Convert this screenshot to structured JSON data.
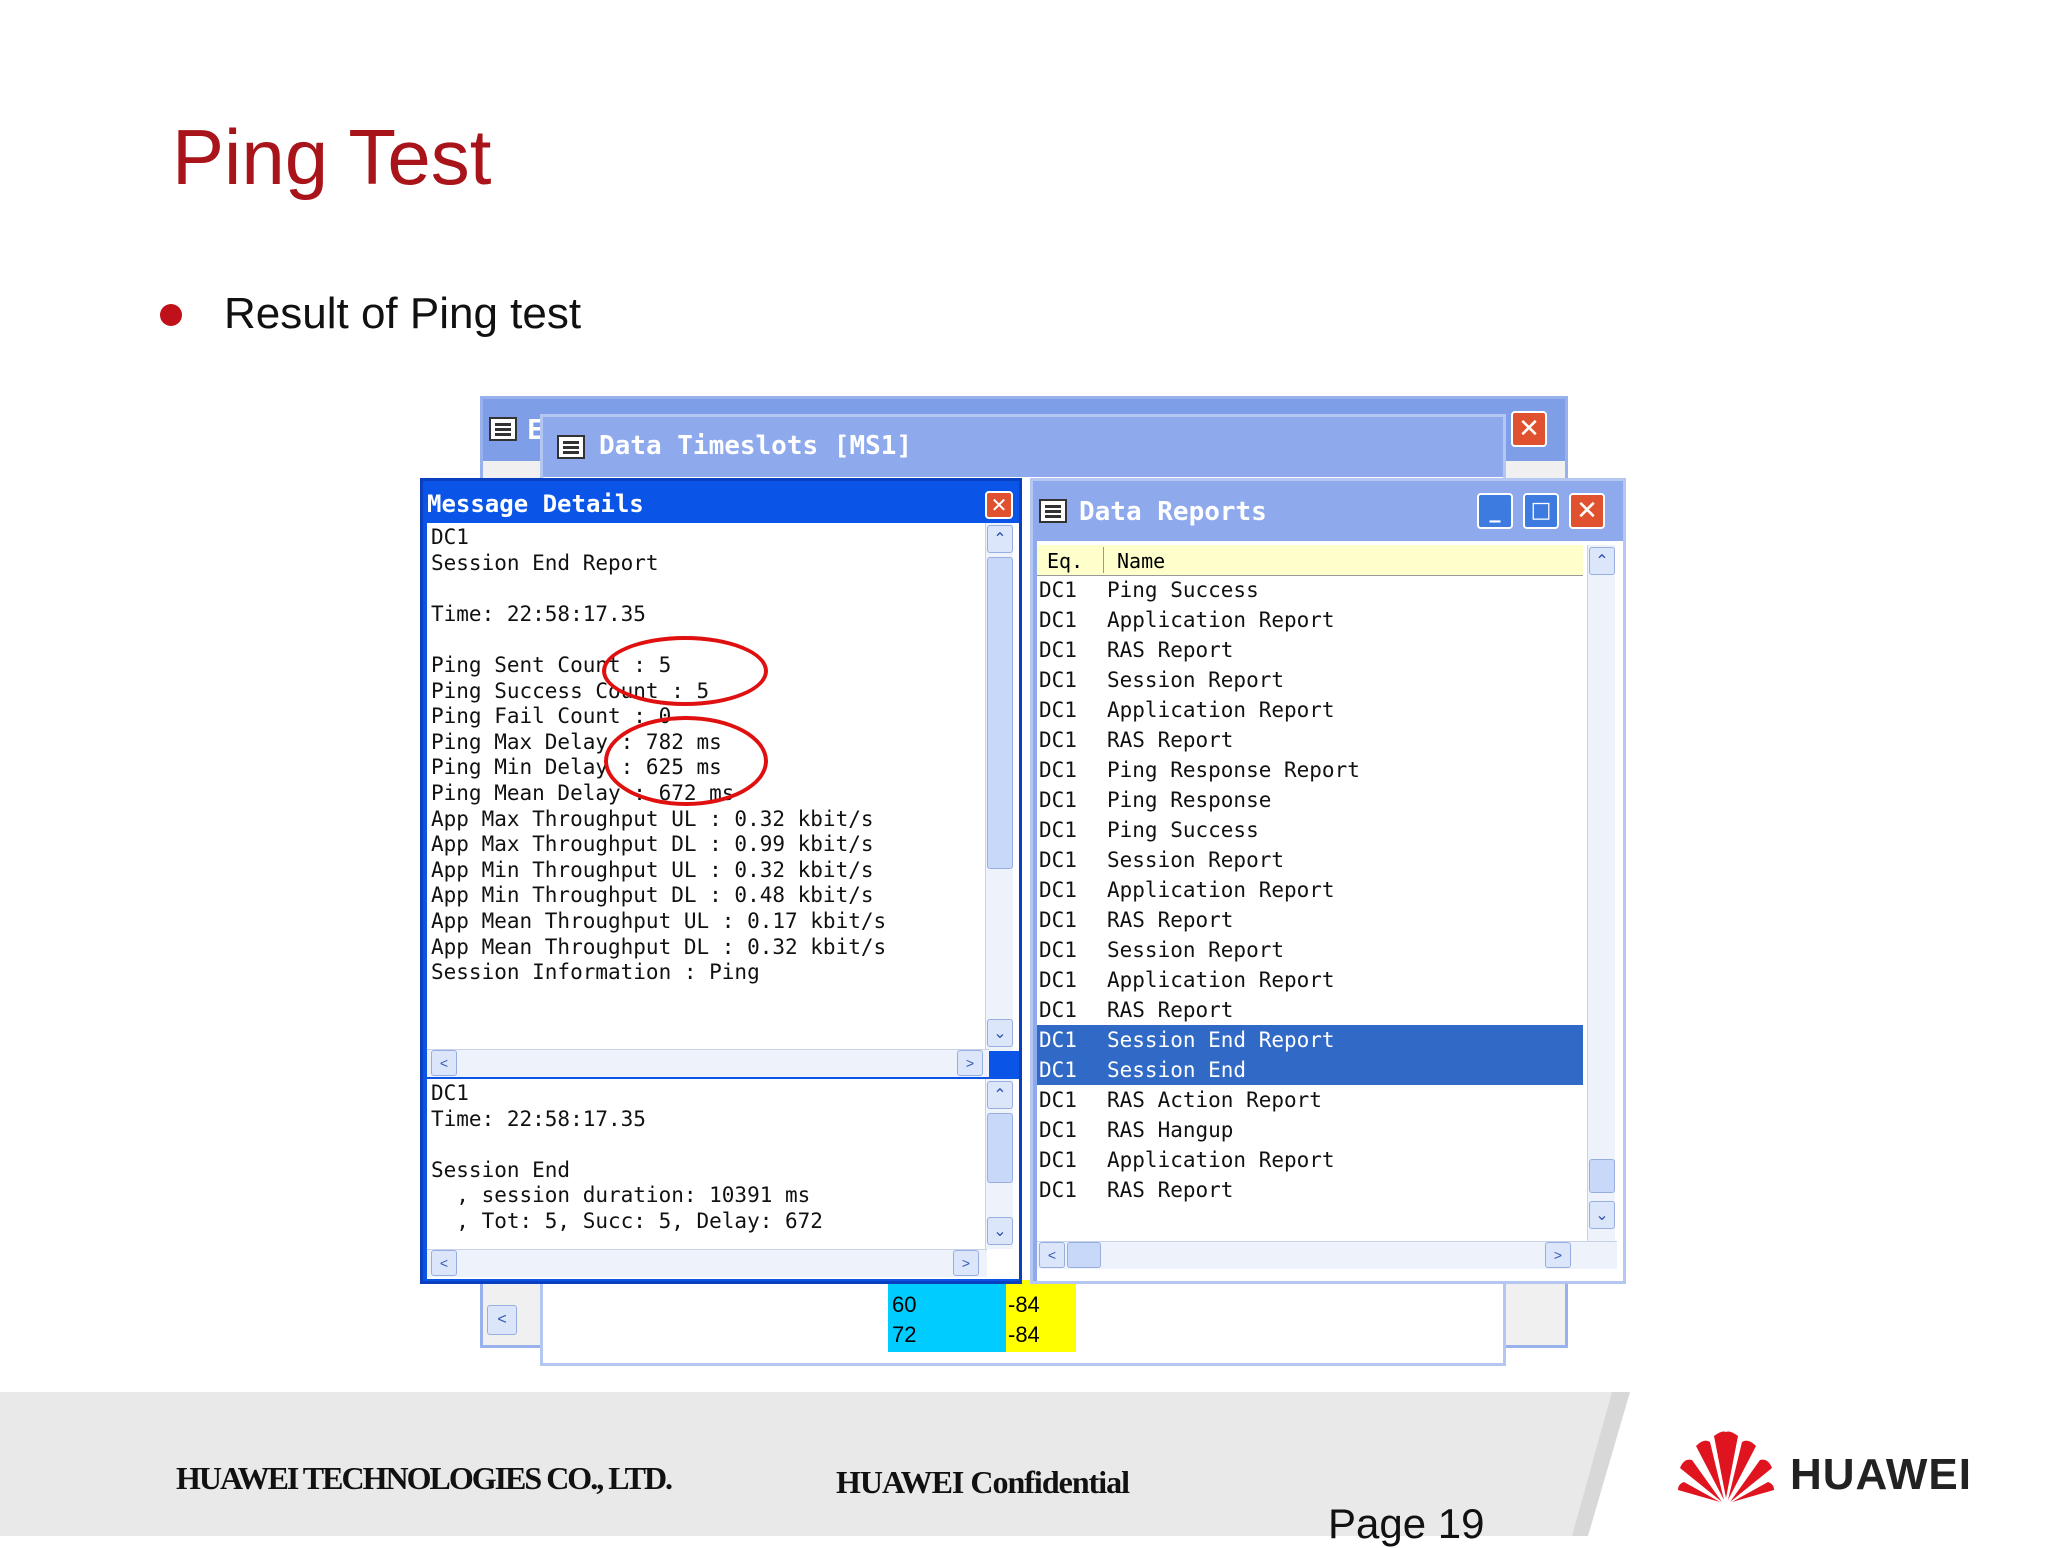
{
  "slide": {
    "title": "Ping Test",
    "bullet": "Result of Ping test"
  },
  "background_windows": {
    "data_timeslots_title": "Data Timeslots [MS1]",
    "back_window_title_fragment": "E",
    "grid_values": [
      {
        "a": "60",
        "b": "-84"
      },
      {
        "a": "72",
        "b": "-84"
      }
    ]
  },
  "message_details": {
    "title": "Message Details",
    "upper_lines": [
      "DC1",
      "Session End Report",
      "",
      "Time: 22:58:17.35",
      "",
      "Ping Sent Count : 5",
      "Ping Success Count : 5",
      "Ping Fail Count : 0",
      "Ping Max Delay : 782 ms",
      "Ping Min Delay : 625 ms",
      "Ping Mean Delay : 672 ms",
      "App Max Throughput UL : 0.32 kbit/s",
      "App Max Throughput DL : 0.99 kbit/s",
      "App Min Throughput UL : 0.32 kbit/s",
      "App Min Throughput DL : 0.48 kbit/s",
      "App Mean Throughput UL : 0.17 kbit/s",
      "App Mean Throughput DL : 0.32 kbit/s",
      "Session Information : Ping"
    ],
    "lower_lines": [
      "DC1",
      "Time: 22:58:17.35",
      "",
      "Session End",
      "  , session duration: 10391 ms",
      "  , Tot: 5, Succ: 5, Delay: 672"
    ]
  },
  "data_reports": {
    "title": "Data Reports",
    "columns": [
      "Eq.",
      "Name"
    ],
    "rows": [
      {
        "eq": "DC1",
        "name": "Ping Success"
      },
      {
        "eq": "DC1",
        "name": "Application Report"
      },
      {
        "eq": "DC1",
        "name": "RAS Report"
      },
      {
        "eq": "DC1",
        "name": "Session Report"
      },
      {
        "eq": "DC1",
        "name": "Application Report"
      },
      {
        "eq": "DC1",
        "name": "RAS Report"
      },
      {
        "eq": "DC1",
        "name": "Ping Response Report"
      },
      {
        "eq": "DC1",
        "name": "Ping Response"
      },
      {
        "eq": "DC1",
        "name": "Ping Success"
      },
      {
        "eq": "DC1",
        "name": "Session Report"
      },
      {
        "eq": "DC1",
        "name": "Application Report"
      },
      {
        "eq": "DC1",
        "name": "RAS Report"
      },
      {
        "eq": "DC1",
        "name": "Session Report"
      },
      {
        "eq": "DC1",
        "name": "Application Report"
      },
      {
        "eq": "DC1",
        "name": "RAS Report"
      },
      {
        "eq": "DC1",
        "name": "Session End Report",
        "selected": true
      },
      {
        "eq": "DC1",
        "name": "Session End",
        "selected": true
      },
      {
        "eq": "DC1",
        "name": "RAS Action Report"
      },
      {
        "eq": "DC1",
        "name": "RAS Hangup"
      },
      {
        "eq": "DC1",
        "name": "Application Report"
      },
      {
        "eq": "DC1",
        "name": "RAS Report"
      }
    ]
  },
  "footer": {
    "company": "HUAWEI TECHNOLOGIES CO., LTD.",
    "confidential": "HUAWEI Confidential",
    "page": "Page 19",
    "brand": "HUAWEI"
  },
  "colors": {
    "title_red": "#a8141a",
    "xp_blue": "#0a55e8",
    "selection_blue": "#3169c6",
    "annotation_red": "#e01010",
    "cell_cyan": "#00ccff",
    "cell_yellow": "#ffff00"
  }
}
